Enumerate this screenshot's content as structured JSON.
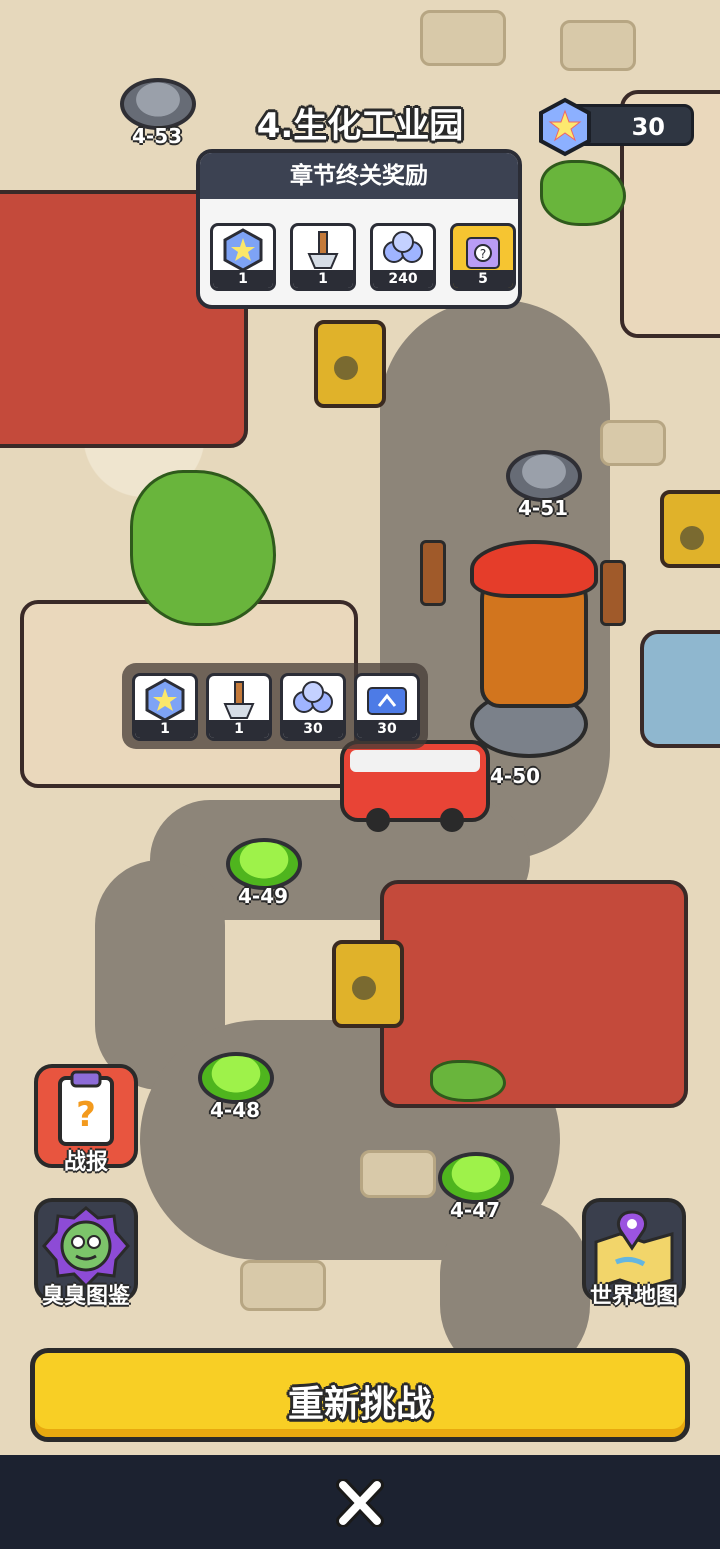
{
  "chapter": {
    "title": "4.生化工业园"
  },
  "currency": {
    "gem_count": "30",
    "gem_icon": "rainbow-star-gem-icon"
  },
  "chapter_rewards": {
    "title": "章节终关奖励",
    "items": [
      {
        "icon": "rainbow-star-gem-icon",
        "qty": "1"
      },
      {
        "icon": "shovel-key-icon",
        "qty": "1"
      },
      {
        "icon": "blue-orbs-icon",
        "qty": "240"
      },
      {
        "icon": "mystery-box-icon",
        "qty": "5"
      }
    ]
  },
  "node_rewards": {
    "items": [
      {
        "icon": "rainbow-star-gem-icon",
        "qty": "1"
      },
      {
        "icon": "shovel-key-icon",
        "qty": "1"
      },
      {
        "icon": "blue-orbs-icon",
        "qty": "30"
      },
      {
        "icon": "blue-ticket-icon",
        "qty": "30"
      }
    ]
  },
  "levels": {
    "l53": "4-53",
    "l51": "4-51",
    "l50": "4-50",
    "l49": "4-49",
    "l48": "4-48",
    "l47": "4-47"
  },
  "buttons": {
    "battle_report": "战报",
    "monster_codex": "臭臭图鉴",
    "world_map": "世界地图",
    "retry": "重新挑战"
  },
  "colors": {
    "accent_yellow": "#f8cf25",
    "node_green": "#4fb51e",
    "node_gray": "#676c76",
    "bottom_bar": "#1c2230"
  }
}
